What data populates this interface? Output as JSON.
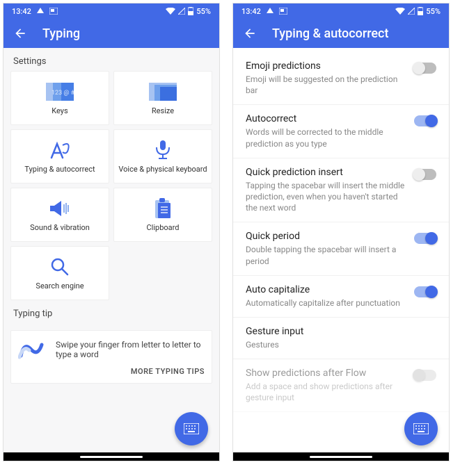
{
  "status": {
    "time": "13:42",
    "battery": "55%"
  },
  "screen1": {
    "title": "Typing",
    "section": "Settings",
    "cards": [
      {
        "label": "Keys"
      },
      {
        "label": "Resize"
      },
      {
        "label": "Typing & autocorrect"
      },
      {
        "label": "Voice & physical keyboard"
      },
      {
        "label": "Sound & vibration"
      },
      {
        "label": "Clipboard"
      },
      {
        "label": "Search engine"
      }
    ],
    "tip_section": "Typing tip",
    "tip_text": "Swipe your finger from letter to letter to type a word",
    "tip_link": "MORE TYPING TIPS"
  },
  "screen2": {
    "title": "Typing & autocorrect",
    "items": [
      {
        "title": "Emoji predictions",
        "sub": "Emoji will be suggested on the prediction bar",
        "on": false,
        "disabled": false
      },
      {
        "title": "Autocorrect",
        "sub": "Words will be corrected to the middle prediction as you type",
        "on": true,
        "disabled": false
      },
      {
        "title": "Quick prediction insert",
        "sub": "Tapping the spacebar will insert the middle prediction, even when you haven't started the next word",
        "on": false,
        "disabled": false
      },
      {
        "title": "Quick period",
        "sub": "Double tapping the spacebar will insert a period",
        "on": true,
        "disabled": false
      },
      {
        "title": "Auto capitalize",
        "sub": "Automatically capitalize after punctuation",
        "on": true,
        "disabled": false
      },
      {
        "title": "Gesture input",
        "sub": "Gestures",
        "on": null,
        "disabled": false
      },
      {
        "title": "Show predictions after Flow",
        "sub": "Add a space and show predictions after gesture input",
        "on": false,
        "disabled": true
      }
    ]
  }
}
